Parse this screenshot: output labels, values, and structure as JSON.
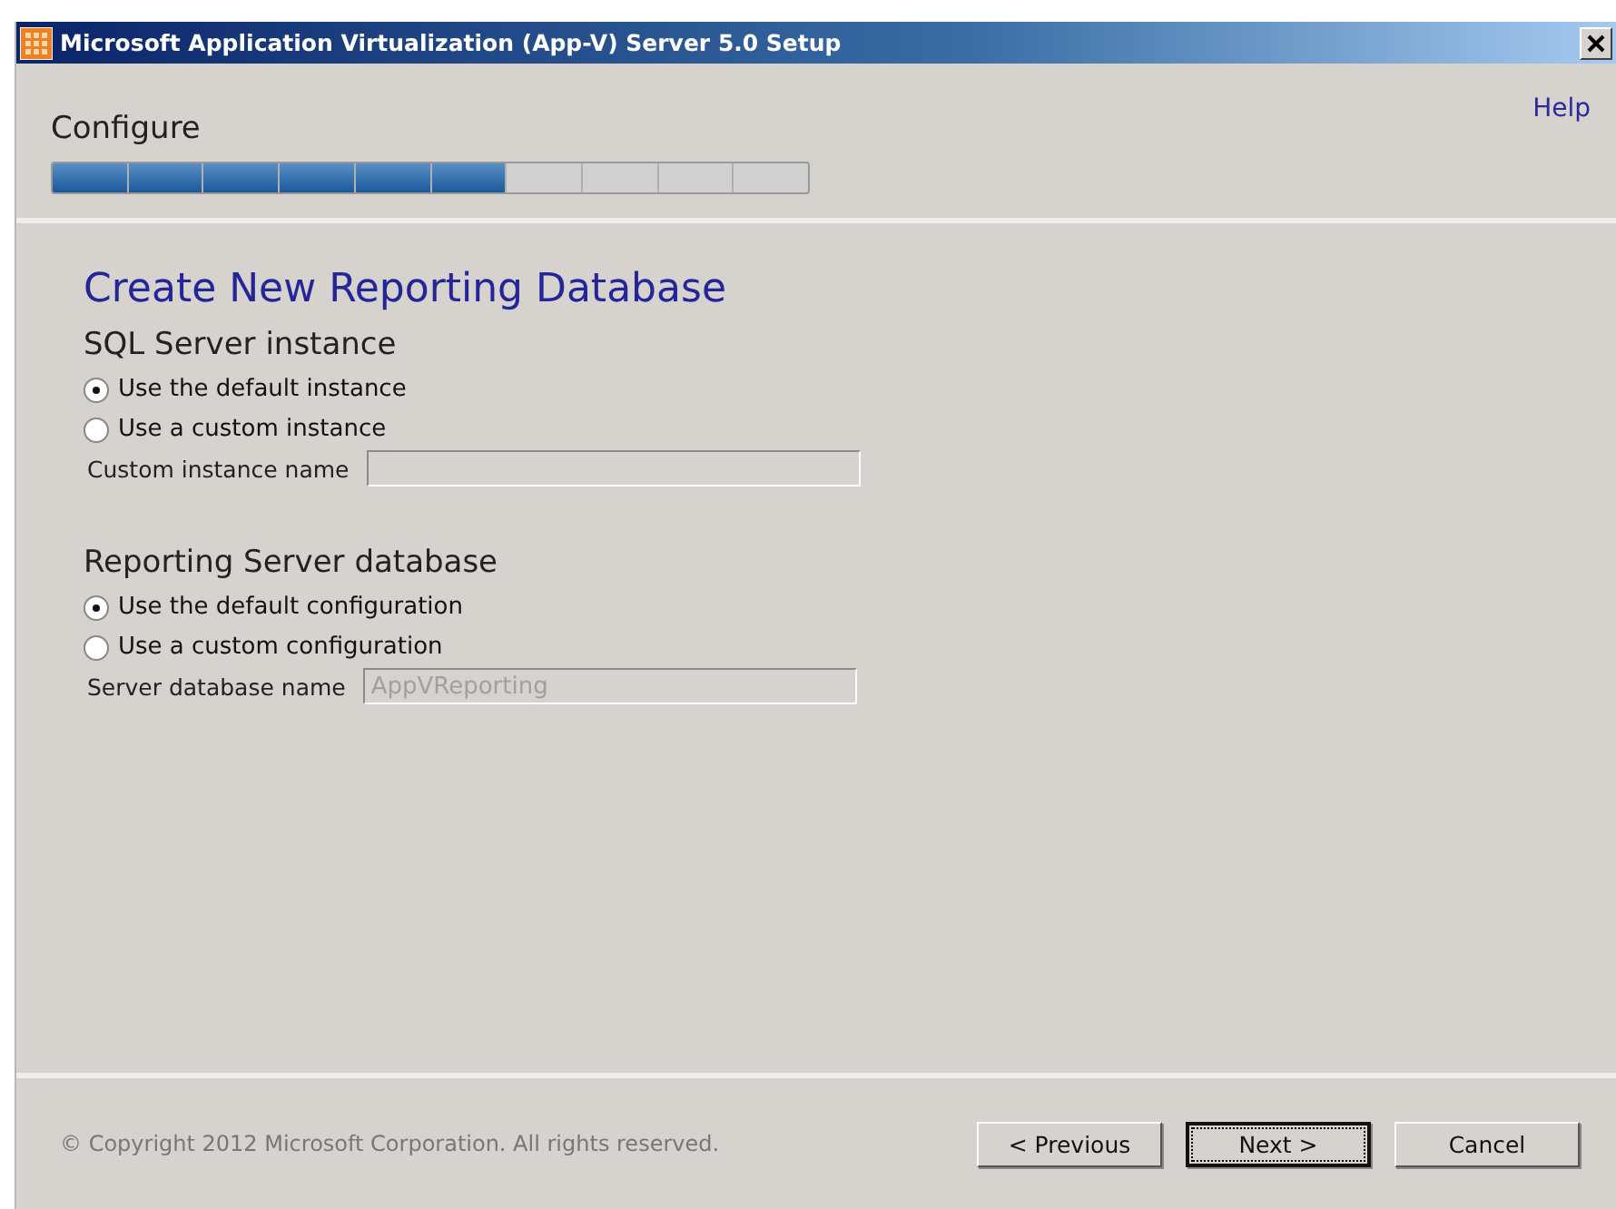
{
  "window": {
    "title": "Microsoft Application Virtualization (App-V) Server 5.0 Setup"
  },
  "header": {
    "title": "Configure",
    "help": "Help",
    "progress": {
      "level": 0.6
    }
  },
  "page_title": "Create New Reporting Database",
  "sections": [
    {
      "heading": "SQL Server instance",
      "options": [
        {
          "label": "Use the default instance",
          "selected": true
        },
        {
          "label": "Use a custom instance",
          "selected": false
        }
      ],
      "field": {
        "label": "Custom instance name"
      }
    },
    {
      "heading": "Reporting Server database",
      "options": [
        {
          "label": "Use the default configuration",
          "selected": true
        },
        {
          "label": "Use a custom configuration",
          "selected": false
        }
      ],
      "field": {
        "label": "Server database name",
        "value": "AppVReporting",
        "disabled": true
      }
    }
  ],
  "footer": {
    "copyright": "© Copyright 2012 Microsoft Corporation. All rights reserved.",
    "buttons": [
      {
        "label": "< Previous",
        "focused": false
      },
      {
        "label": "Next >",
        "focused": true
      },
      {
        "label": "Cancel",
        "focused": false
      }
    ]
  }
}
